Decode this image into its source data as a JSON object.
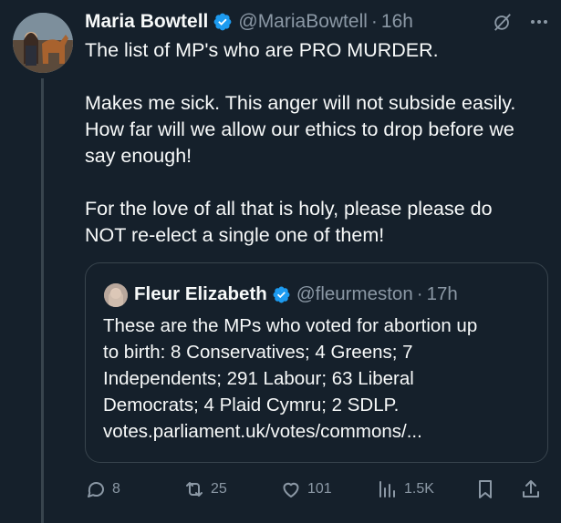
{
  "tweet": {
    "author": {
      "name": "Maria Bowtell",
      "handle": "@MariaBowtell",
      "time": "16h",
      "verified": true
    },
    "text_lines": [
      "The list of MP's who are PRO MURDER.",
      "",
      "Makes me sick. This anger will not subside easily.",
      "How far will we allow our ethics to drop before we",
      "say enough!",
      "",
      "For the love of all that is holy, please please do",
      "NOT re-elect a single one of them!"
    ],
    "header_icons": [
      "grok-icon",
      "more-icon"
    ]
  },
  "quote": {
    "author": {
      "name": "Fleur Elizabeth",
      "handle": "@fleurmeston",
      "time": "17h",
      "verified": true
    },
    "text_lines": [
      "These are the MPs who voted for abortion up",
      "to birth: 8 Conservatives; 4 Greens; 7",
      "Independents; 291 Labour; 63 Liberal",
      "Democrats; 4 Plaid Cymru; 2 SDLP.",
      "votes.parliament.uk/votes/commons/..."
    ]
  },
  "actions": {
    "replies": "8",
    "reposts": "25",
    "likes": "101",
    "views": "1.5K"
  },
  "colors": {
    "background": "#15202b",
    "text": "#f7f9f9",
    "secondary": "#8b98a5",
    "border": "#38444d",
    "verified": "#1d9bf0"
  }
}
